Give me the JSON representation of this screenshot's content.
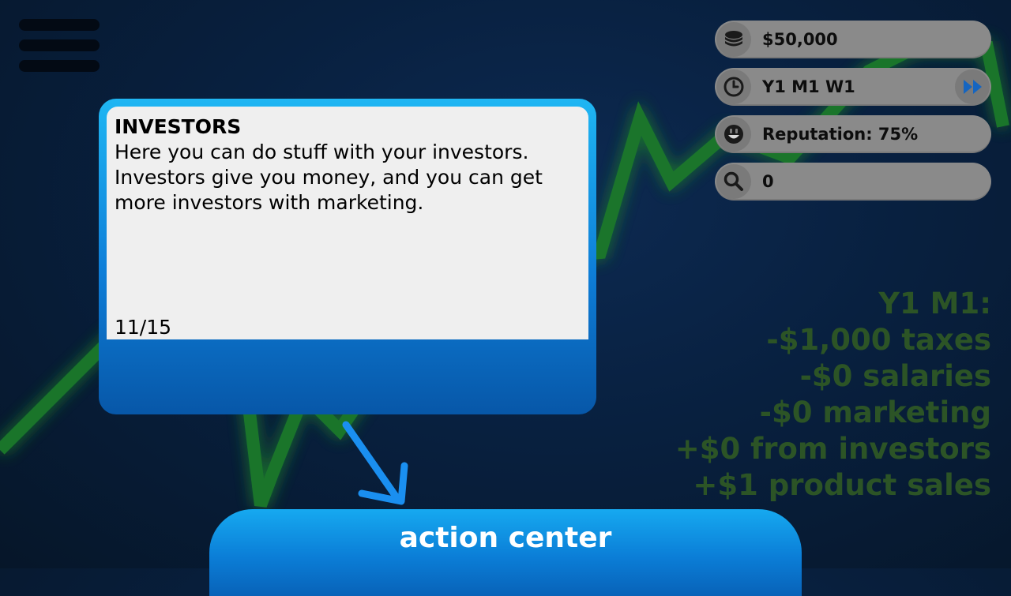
{
  "menu": {
    "icon": "hamburger-menu-icon"
  },
  "stats": {
    "money": {
      "icon": "coins-icon",
      "value": "$50,000"
    },
    "date": {
      "icon": "clock-icon",
      "value": "Y1 M1 W1",
      "fast_forward_icon": "fast-forward-icon"
    },
    "reputation": {
      "icon": "smiley-face-icon",
      "value": "Reputation: 75%"
    },
    "search": {
      "icon": "magnifier-icon",
      "value": "0"
    }
  },
  "summary": {
    "lines": [
      "Y1 M1:",
      "-$1,000 taxes",
      "-$0 salaries",
      "-$0 marketing",
      "+$0 from investors",
      "+$1 product sales"
    ]
  },
  "dialog": {
    "title": "INVESTORS",
    "body": "Here you can do stuff with your investors. Investors give you money, and you can get more investors with marketing.",
    "page": "11/15"
  },
  "action_center": {
    "label": "action center"
  },
  "colors": {
    "accent_blue": "#0e7ed8",
    "summary_green": "#2c5426",
    "pill_gray": "#8a8a8a",
    "chart_green": "#1f8a2a"
  }
}
